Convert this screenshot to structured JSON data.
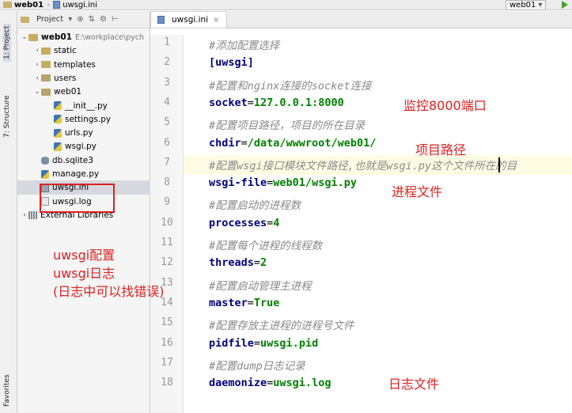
{
  "topbar": {
    "project": "web01",
    "file": "uwsgi.ini",
    "run_config": "web01"
  },
  "left_strip": {
    "project_tab": "1: Project",
    "structure_tab": "7: Structure",
    "favorites_tab": "Favorites"
  },
  "project_panel": {
    "toolbar_label": "Project",
    "tree": [
      {
        "label": "web01",
        "path": "E:\\workplace\\pych",
        "type": "root",
        "depth": 0,
        "expanded": true
      },
      {
        "label": "static",
        "type": "dir",
        "depth": 1,
        "expanded": false
      },
      {
        "label": "templates",
        "type": "dir",
        "depth": 1,
        "expanded": false
      },
      {
        "label": "users",
        "type": "pkg",
        "depth": 1,
        "expanded": false
      },
      {
        "label": "web01",
        "type": "pkg",
        "depth": 1,
        "expanded": true
      },
      {
        "label": "__init__.py",
        "type": "py",
        "depth": 2
      },
      {
        "label": "settings.py",
        "type": "py",
        "depth": 2
      },
      {
        "label": "urls.py",
        "type": "py",
        "depth": 2
      },
      {
        "label": "wsgi.py",
        "type": "py",
        "depth": 2
      },
      {
        "label": "db.sqlite3",
        "type": "db",
        "depth": 1
      },
      {
        "label": "manage.py",
        "type": "py",
        "depth": 1
      },
      {
        "label": "uwsgi.ini",
        "type": "ini",
        "depth": 1,
        "selected": true
      },
      {
        "label": "uwsgi.log",
        "type": "log",
        "depth": 1
      },
      {
        "label": "External Libraries",
        "type": "lib",
        "depth": 0,
        "expanded": false
      }
    ]
  },
  "editor": {
    "tab_label": "uwsgi.ini",
    "lines": [
      {
        "n": "1",
        "kind": "comment",
        "text": "#添加配置选择"
      },
      {
        "n": "2",
        "kind": "section",
        "text": "[uwsgi]"
      },
      {
        "n": "3",
        "kind": "comment",
        "text": "#配置和nginx连接的socket连接"
      },
      {
        "n": "4",
        "kind": "kv",
        "key": "socket",
        "value": "127.0.0.1:8000"
      },
      {
        "n": "5",
        "kind": "comment",
        "text": "#配置项目路径，项目的所在目录"
      },
      {
        "n": "6",
        "kind": "kv",
        "key": "chdir",
        "value": "/data/wwwroot/web01/"
      },
      {
        "n": "7",
        "kind": "comment",
        "text": "#配置wsgi接口模块文件路径,也就是wsgi.py这个文件所在的目"
      },
      {
        "n": "8",
        "kind": "kv",
        "key": "wsgi-file",
        "value": "web01/wsgi.py"
      },
      {
        "n": "9",
        "kind": "comment",
        "text": "#配置启动的进程数"
      },
      {
        "n": "10",
        "kind": "kv",
        "key": "processes",
        "value": "4"
      },
      {
        "n": "11",
        "kind": "comment",
        "text": "#配置每个进程的线程数"
      },
      {
        "n": "12",
        "kind": "kv",
        "key": "threads",
        "value": "2"
      },
      {
        "n": "13",
        "kind": "comment",
        "text": "#配置启动管理主进程"
      },
      {
        "n": "14",
        "kind": "kv",
        "key": "master",
        "value": "True"
      },
      {
        "n": "15",
        "kind": "comment",
        "text": "#配置存放主进程的进程号文件"
      },
      {
        "n": "16",
        "kind": "kv",
        "key": "pidfile",
        "value": "uwsgi.pid"
      },
      {
        "n": "17",
        "kind": "comment",
        "text": "#配置dump日志记录"
      },
      {
        "n": "18",
        "kind": "kv",
        "key": "daemonize",
        "value": "uwsgi.log"
      }
    ]
  },
  "annotations": {
    "listen_port": "监控8000端口",
    "project_path": "项目路径",
    "process_file": "进程文件",
    "log_file": "日志文件",
    "uwsgi_config": "uwsgi配置",
    "uwsgi_log": "uwsgi日志",
    "log_hint": "(日志中可以找错误)"
  },
  "colors": {
    "annotation_red": "#e02020",
    "key_blue": "#000080",
    "value_green": "#008000",
    "comment_gray": "#8a8a8a"
  }
}
